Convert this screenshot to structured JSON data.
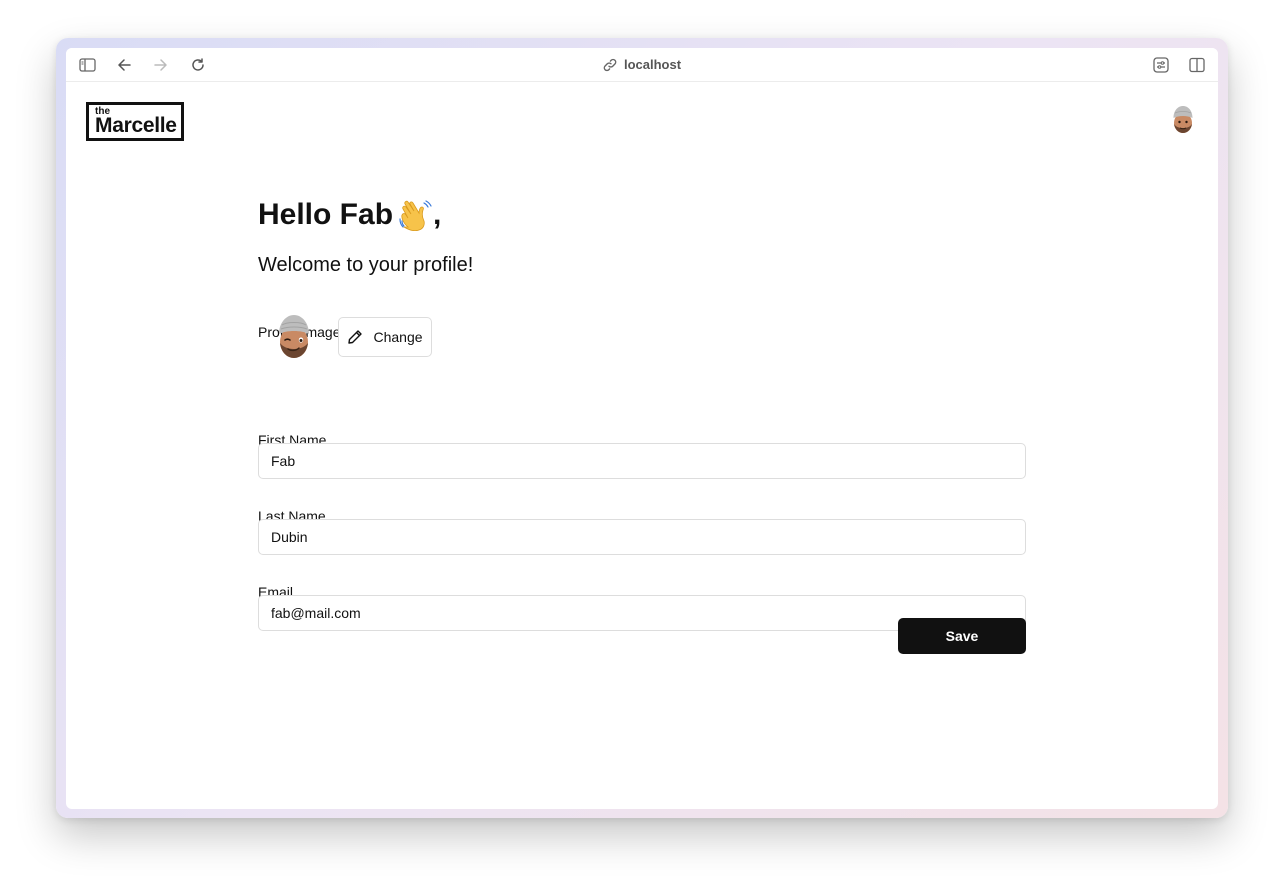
{
  "browser": {
    "address": "localhost",
    "icons": [
      "sidebar-icon",
      "back-icon",
      "forward-icon",
      "reload-icon",
      "link-icon",
      "extensions-icon",
      "split-view-icon"
    ]
  },
  "header": {
    "logo_small": "the",
    "logo_main": "Marcelle"
  },
  "profile": {
    "greeting": "Hello Fab",
    "greeting_suffix": ",",
    "subtitle": "Welcome to your profile!",
    "image_label": "Profile Image",
    "change_label": "Change",
    "first_name_label": "First Name",
    "first_name_value": "Fab",
    "last_name_label": "Last Name",
    "last_name_value": "Dubin",
    "email_label": "Email",
    "email_value": "fab@mail.com",
    "save_label": "Save"
  },
  "colors": {
    "primary_button": "#111111",
    "border": "#dddddd"
  }
}
